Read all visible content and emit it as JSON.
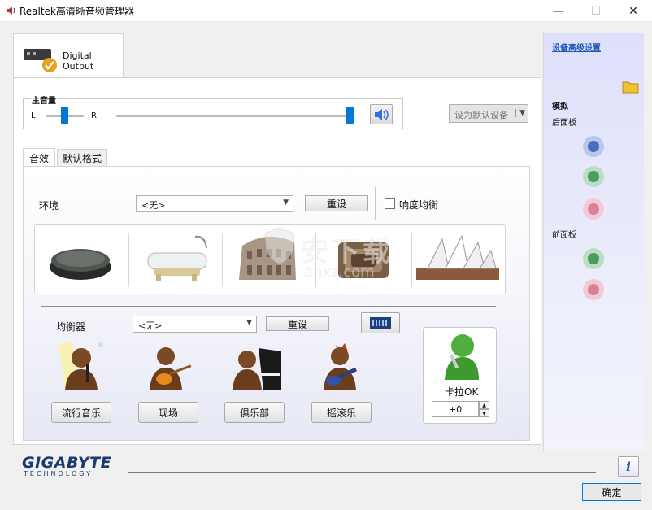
{
  "window": {
    "title": "Realtek高清晰音频管理器",
    "minimize_glyph": "—",
    "maximize_glyph": "☐",
    "close_glyph": "✕"
  },
  "device_tab": {
    "label": "Digital Output"
  },
  "volume": {
    "title": "主音量",
    "left_label": "L",
    "right_label": "R",
    "balance_level": 0.5,
    "master_level": 1.0
  },
  "default_device": {
    "label": "设为默认设备"
  },
  "effect_tabs": [
    {
      "label": "音效",
      "active": true
    },
    {
      "label": "默认格式",
      "active": false
    }
  ],
  "environment": {
    "label": "环境",
    "selected": "<无>",
    "reset_label": "重设",
    "loudness_label": "响度均衡",
    "loudness_checked": false
  },
  "equalizer": {
    "label": "均衡器",
    "selected": "<无>",
    "reset_label": "重设",
    "presets": [
      {
        "label": "流行音乐"
      },
      {
        "label": "现场"
      },
      {
        "label": "俱乐部"
      },
      {
        "label": "摇滚乐"
      }
    ]
  },
  "karaoke": {
    "label": "卡拉OK",
    "value": "+0"
  },
  "right_panel": {
    "advanced_link": "设备高级设置",
    "analog_label": "模拟",
    "back_panel_label": "后面板",
    "front_panel_label": "前面板"
  },
  "brand": {
    "name": "GIGABYTE",
    "sub": "TECHNOLOGY"
  },
  "ok_label": "确定",
  "watermark": "anxz.com",
  "colors": {
    "accent": "#0078d7",
    "jack_blue": "#4a6fc0",
    "jack_green": "#4b9c5f",
    "jack_pink": "#d9819b",
    "link": "#1d55b6",
    "brand": "#1c3a6b"
  }
}
